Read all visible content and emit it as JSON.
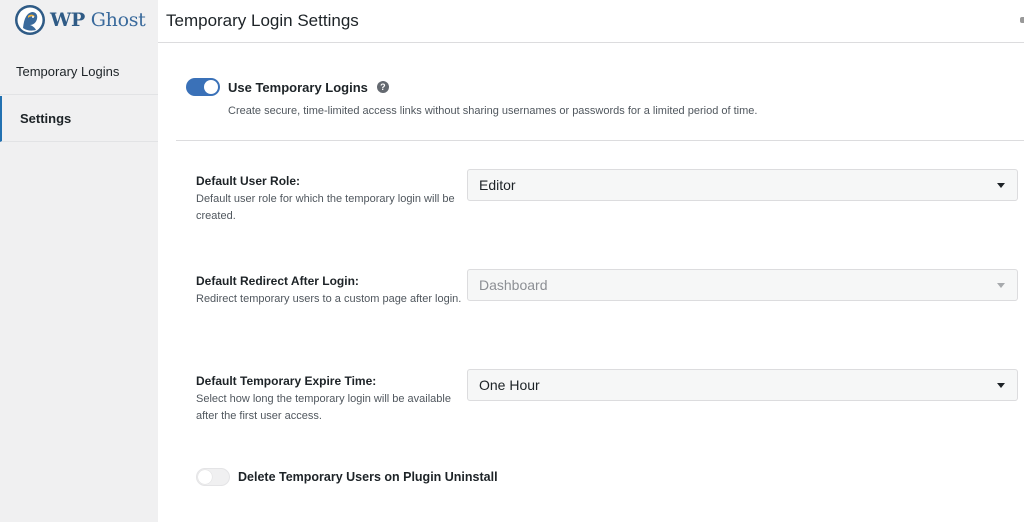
{
  "brand": {
    "name_first": "WP",
    "name_rest": " Ghost"
  },
  "sidebar": {
    "items": [
      {
        "label": "Temporary Logins",
        "active": false
      },
      {
        "label": "Settings",
        "active": true
      }
    ]
  },
  "header": {
    "title": "Temporary Login Settings"
  },
  "use_temporary_logins": {
    "label": "Use Temporary Logins",
    "enabled": true,
    "description": "Create secure, time-limited access links without sharing usernames or passwords for a limited period of time.",
    "help_icon": "?"
  },
  "fields": [
    {
      "label": "Default User Role:",
      "description": "Default user role for which the temporary login will be created.",
      "value": "Editor",
      "disabled": false
    },
    {
      "label": "Default Redirect After Login:",
      "description": "Redirect temporary users to a custom page after login.",
      "value": "Dashboard",
      "disabled": true
    },
    {
      "label": "Default Temporary Expire Time:",
      "description": "Select how long the temporary login will be available after the first user access.",
      "value": "One Hour",
      "disabled": false
    }
  ],
  "delete_on_uninstall": {
    "label": "Delete Temporary Users on Plugin Uninstall",
    "enabled": false
  },
  "colors": {
    "accent": "#3a71b8",
    "brand": "#2f5b86"
  }
}
